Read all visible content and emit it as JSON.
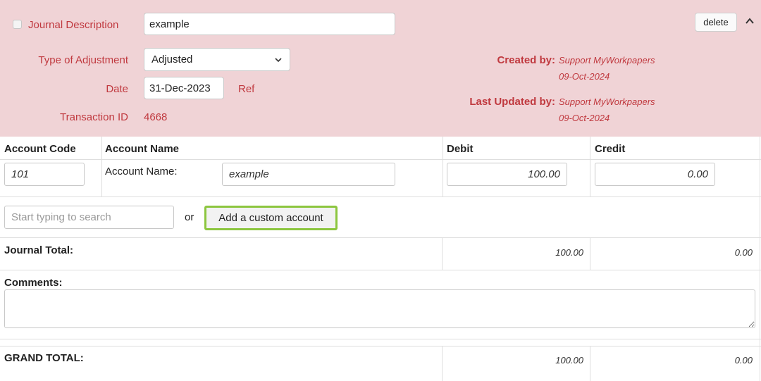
{
  "journal": {
    "description_label": "Journal Description",
    "description_value": "example",
    "type_label": "Type of Adjustment",
    "type_value": "Adjusted",
    "date_label": "Date",
    "date_value": "31-Dec-2023",
    "ref_label": "Ref",
    "transaction_label": "Transaction ID",
    "transaction_value": "4668",
    "delete_label": "delete"
  },
  "meta": {
    "created_label": "Created by:",
    "created_by": "Support MyWorkpapers",
    "created_date": "09-Oct-2024",
    "updated_label": "Last Updated by:",
    "updated_by": "Support MyWorkpapers",
    "updated_date": "09-Oct-2024"
  },
  "table": {
    "headers": [
      "Account Code",
      "Account Name",
      "Debit",
      "Credit"
    ],
    "rows": [
      {
        "code": "101",
        "name_label": "Account Name:",
        "name_value": "example",
        "debit": "100.00",
        "credit": "0.00"
      }
    ]
  },
  "search": {
    "placeholder": "Start typing to search",
    "or_text": "or",
    "custom_button": "Add a custom account"
  },
  "totals": {
    "journal_label": "Journal Total:",
    "journal_debit": "100.00",
    "journal_credit": "0.00",
    "comments_label": "Comments:",
    "grand_label": "GRAND TOTAL:",
    "grand_debit": "100.00",
    "grand_credit": "0.00"
  },
  "colors": {
    "header_bg": "#f0d3d6",
    "label_red": "#c0393f",
    "highlight_green": "#8cc63f"
  }
}
